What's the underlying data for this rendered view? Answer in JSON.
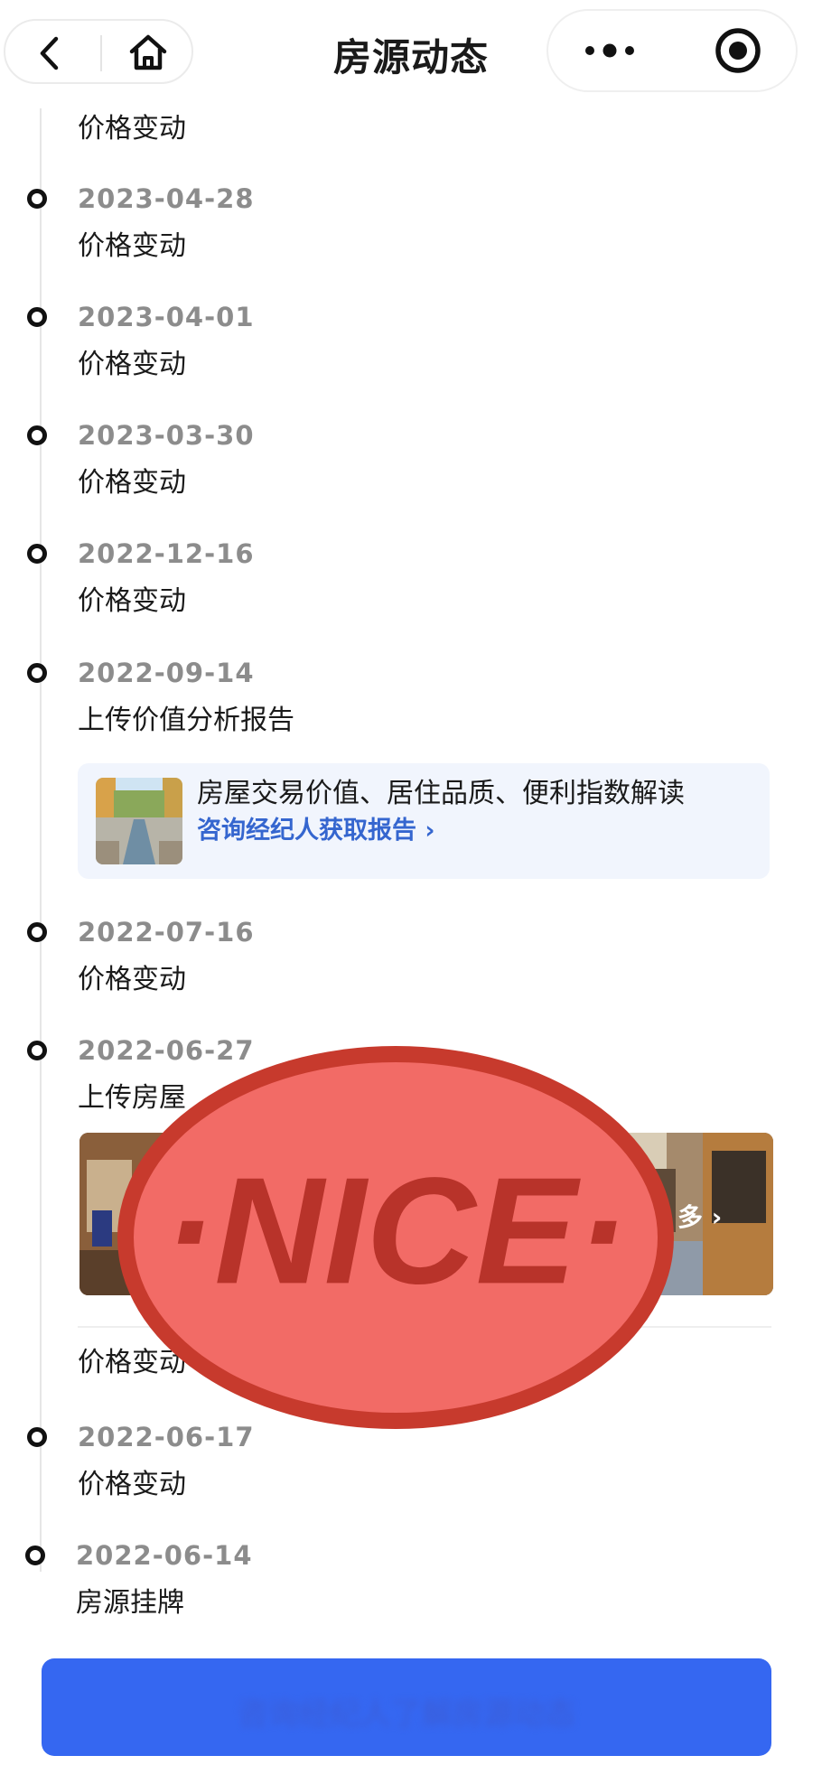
{
  "header": {
    "title": "房源动态",
    "back_icon": "chevron-left-icon",
    "home_icon": "home-icon",
    "more_icon": "more-dots-icon",
    "record_icon": "record-icon"
  },
  "timeline": {
    "top_event": "价格变动",
    "items": [
      {
        "date": "2023-04-28",
        "event": "价格变动"
      },
      {
        "date": "2023-04-01",
        "event": "价格变动"
      },
      {
        "date": "2023-03-30",
        "event": "价格变动"
      },
      {
        "date": "2022-12-16",
        "event": "价格变动"
      },
      {
        "date": "2022-09-14",
        "event": "上传价值分析报告"
      },
      {
        "date": "2022-07-16",
        "event": "价格变动"
      },
      {
        "date": "2022-06-27",
        "event": "上传房屋"
      },
      {
        "date": "2022-06-17",
        "event": "价格变动"
      },
      {
        "date": "2022-06-14",
        "event": "房源挂牌"
      }
    ],
    "after_photos_event": "价格变动"
  },
  "report_card": {
    "text": "房屋交易价值、居住品质、便利指数解读",
    "link": "咨询经纪人获取报告",
    "link_arrow": "›"
  },
  "photo_strip": {
    "more_text": "多",
    "more_arrow": "›"
  },
  "stamp": {
    "text": "·NICE·",
    "fill_color": "#f26b66",
    "border_color": "#c73a2d"
  },
  "bottom_button": {
    "label": "咨询经纪人了解房源动态",
    "color": "#3567f1"
  },
  "colors": {
    "accent_link": "#3566cf",
    "date_gray": "#8c8c8c",
    "card_bg": "#f1f5fd"
  }
}
